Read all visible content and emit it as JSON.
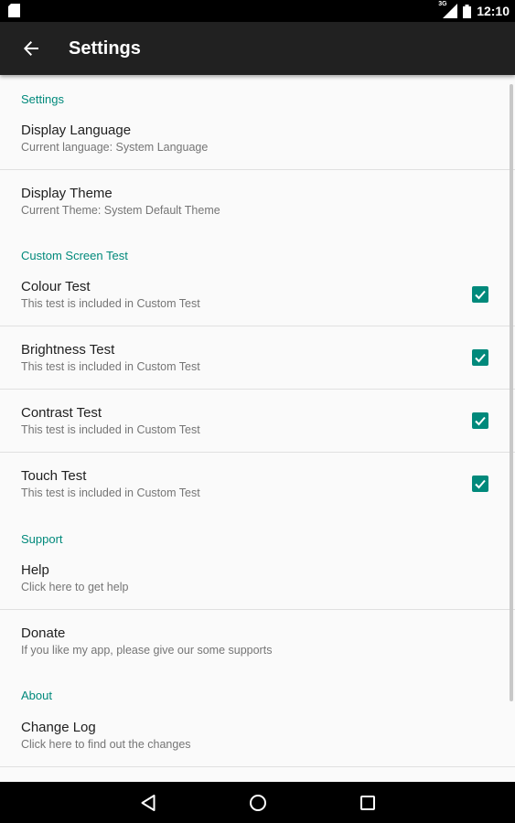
{
  "status_bar": {
    "network": "3G",
    "time": "12:10"
  },
  "app_bar": {
    "title": "Settings"
  },
  "sections": {
    "settings": {
      "header": "Settings",
      "display_language": {
        "title": "Display Language",
        "summary": "Current language: System Language"
      },
      "display_theme": {
        "title": "Display Theme",
        "summary": "Current Theme: System Default Theme"
      }
    },
    "custom_screen_test": {
      "header": "Custom Screen Test",
      "colour_test": {
        "title": "Colour Test",
        "summary": "This test is included in Custom Test",
        "checked": true
      },
      "brightness_test": {
        "title": "Brightness Test",
        "summary": "This test is included in Custom Test",
        "checked": true
      },
      "contrast_test": {
        "title": "Contrast Test",
        "summary": "This test is included in Custom Test",
        "checked": true
      },
      "touch_test": {
        "title": "Touch Test",
        "summary": "This test is included in Custom Test",
        "checked": true
      }
    },
    "support": {
      "header": "Support",
      "help": {
        "title": "Help",
        "summary": "Click here to get help"
      },
      "donate": {
        "title": "Donate",
        "summary": "If you like my app, please give our some supports"
      }
    },
    "about": {
      "header": "About",
      "change_log": {
        "title": "Change Log",
        "summary": "Click here to find out the changes"
      }
    }
  },
  "colors": {
    "accent": "#00897b",
    "app_bar": "#212121",
    "background": "#fafafa"
  }
}
